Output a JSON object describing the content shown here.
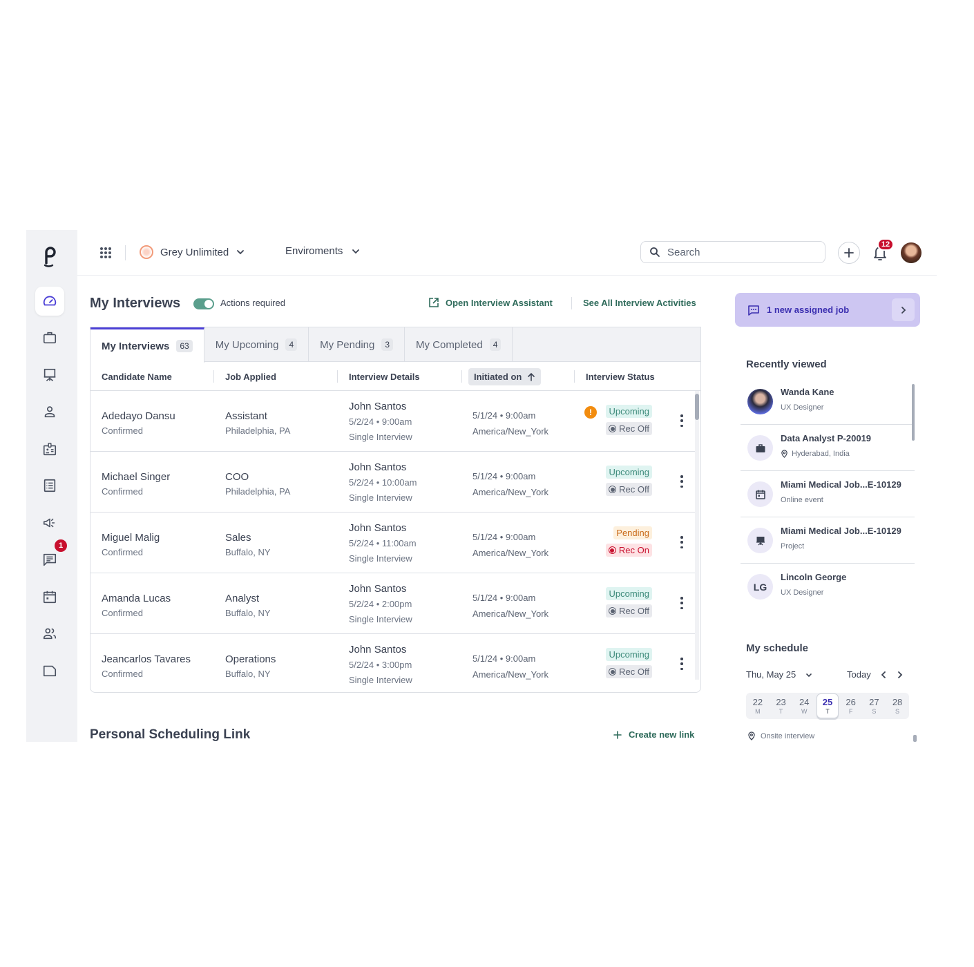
{
  "topbar": {
    "org_name": "Grey Unlimited",
    "env_label": "Enviroments",
    "search_placeholder": "Search",
    "notifications_count": "12"
  },
  "rail": {
    "items": [
      {
        "name": "dashboard",
        "active": true
      },
      {
        "name": "jobs"
      },
      {
        "name": "projects"
      },
      {
        "name": "candidates"
      },
      {
        "name": "employees"
      },
      {
        "name": "lists"
      },
      {
        "name": "campaigns"
      },
      {
        "name": "messages",
        "badge": "1"
      },
      {
        "name": "calendar"
      },
      {
        "name": "teams"
      },
      {
        "name": "documents"
      }
    ]
  },
  "main": {
    "title": "My Interviews",
    "toggle_label": "Actions required",
    "toggle_on": true,
    "open_assistant_label": "Open Interview Assistant",
    "see_all_label": "See All Interview Activities",
    "tabs": [
      {
        "label": "My Interviews",
        "count": "63",
        "active": true
      },
      {
        "label": "My Upcoming",
        "count": "4"
      },
      {
        "label": "My Pending",
        "count": "3"
      },
      {
        "label": "My Completed",
        "count": "4"
      }
    ],
    "columns": {
      "candidate": "Candidate Name",
      "job": "Job Applied",
      "details": "Interview Details",
      "initiated": "Initiated on",
      "status": "Interview Status"
    },
    "rows": [
      {
        "name": "Adedayo Dansu",
        "name_status": "Confirmed",
        "job": "Assistant",
        "location": "Philadelphia, PA",
        "interviewer": "John Santos",
        "datetime": "5/2/24 • 9:00am",
        "type": "Single Interview",
        "initiated": "5/1/24 • 9:00am",
        "tz": "America/New_York",
        "status": "Upcoming",
        "rec": "Rec Off",
        "warning": true
      },
      {
        "name": "Michael Singer",
        "name_status": "Confirmed",
        "job": "COO",
        "location": "Philadelphia, PA",
        "interviewer": "John Santos",
        "datetime": "5/2/24 • 10:00am",
        "type": "Single Interview",
        "initiated": "5/1/24 • 9:00am",
        "tz": "America/New_York",
        "status": "Upcoming",
        "rec": "Rec Off"
      },
      {
        "name": "Miguel Malig",
        "name_status": "Confirmed",
        "job": "Sales",
        "location": "Buffalo, NY",
        "interviewer": "John Santos",
        "datetime": "5/2/24 • 11:00am",
        "type": "Single Interview",
        "initiated": "5/1/24 • 9:00am",
        "tz": "America/New_York",
        "status": "Pending",
        "rec": "Rec On"
      },
      {
        "name": "Amanda Lucas",
        "name_status": "Confirmed",
        "job": "Analyst",
        "location": "Buffalo, NY",
        "interviewer": "John Santos",
        "datetime": "5/2/24 • 2:00pm",
        "type": "Single Interview",
        "initiated": "5/1/24 • 9:00am",
        "tz": "America/New_York",
        "status": "Upcoming",
        "rec": "Rec Off"
      },
      {
        "name": "Jeancarlos Tavares",
        "name_status": "Confirmed",
        "job": "Operations",
        "location": "Buffalo, NY",
        "interviewer": "John Santos",
        "datetime": "5/2/24 • 3:00pm",
        "type": "Single Interview",
        "initiated": "5/1/24 • 9:00am",
        "tz": "America/New_York",
        "status": "Upcoming",
        "rec": "Rec Off"
      }
    ],
    "scheduling_title": "Personal Scheduling Link",
    "create_link_label": "Create new link"
  },
  "side": {
    "assigned_label": "1 new assigned job",
    "recently_viewed_title": "Recently viewed",
    "recent": [
      {
        "title": "Wanda Kane",
        "sub": "UX Designer",
        "kind": "person-photo"
      },
      {
        "title": "Data Analyst P-20019",
        "sub": "Hyderabad, India",
        "kind": "job"
      },
      {
        "title": "Miami Medical Job...E-10129",
        "sub": "Online event",
        "kind": "event"
      },
      {
        "title": "Miami Medical Job...E-10129",
        "sub": "Project",
        "kind": "project"
      },
      {
        "title": "Lincoln George",
        "sub": "UX Designer",
        "kind": "initials",
        "initials": "LG"
      }
    ],
    "schedule_title": "My schedule",
    "schedule_date": "Thu, May 25",
    "today_label": "Today",
    "week": [
      {
        "num": "22",
        "dow": "M"
      },
      {
        "num": "23",
        "dow": "T"
      },
      {
        "num": "24",
        "dow": "W"
      },
      {
        "num": "25",
        "dow": "T",
        "selected": true
      },
      {
        "num": "26",
        "dow": "F"
      },
      {
        "num": "27",
        "dow": "S"
      },
      {
        "num": "28",
        "dow": "S"
      }
    ],
    "onsite_label": "Onsite interview"
  }
}
